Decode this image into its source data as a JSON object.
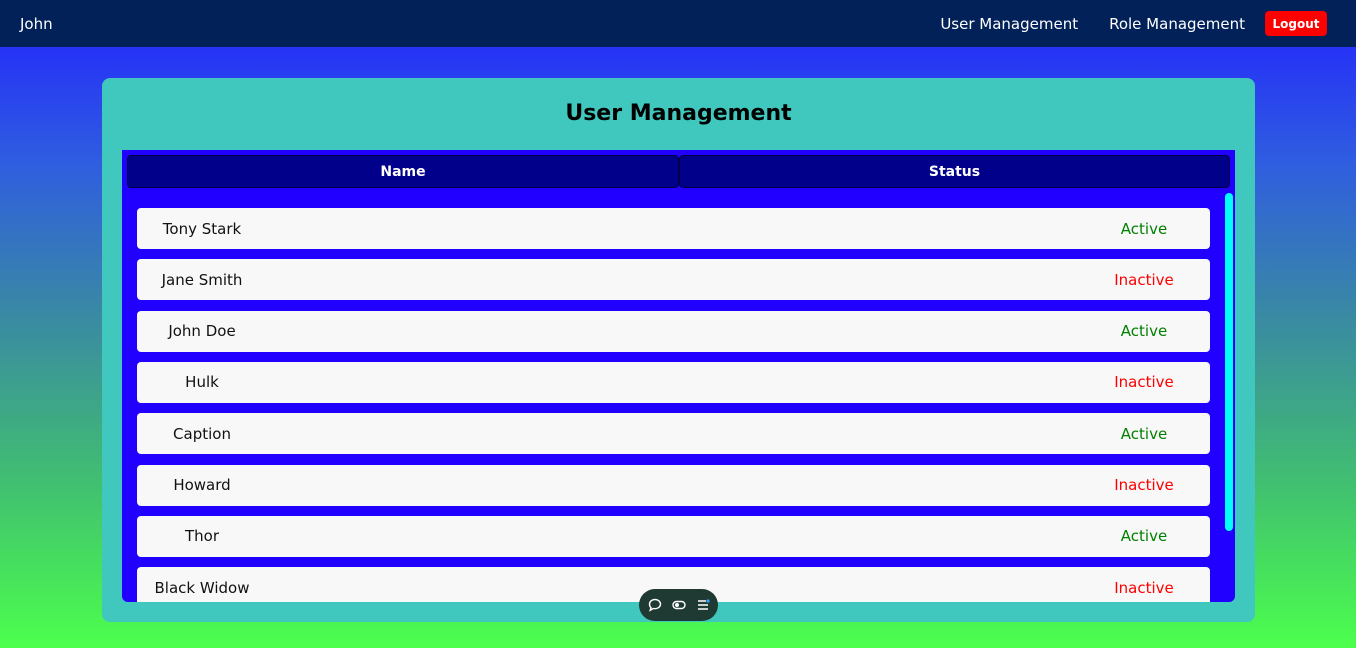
{
  "navbar": {
    "brand": "John",
    "links": [
      "User Management",
      "Role Management"
    ],
    "logout_label": "Logout"
  },
  "card": {
    "title": "User Management",
    "columns": [
      "Name",
      "Status"
    ]
  },
  "users": [
    {
      "name": "Tony Stark",
      "status": "Active"
    },
    {
      "name": "Jane Smith",
      "status": "Inactive"
    },
    {
      "name": "John Doe",
      "status": "Active"
    },
    {
      "name": "Hulk",
      "status": "Inactive"
    },
    {
      "name": "Caption",
      "status": "Active"
    },
    {
      "name": "Howard",
      "status": "Inactive"
    },
    {
      "name": "Thor",
      "status": "Active"
    },
    {
      "name": "Black Widow",
      "status": "Inactive"
    }
  ],
  "toolbar": {
    "icons": [
      "chat-bubble-icon",
      "toggle-icon",
      "list-icon"
    ]
  },
  "colors": {
    "navbar": "#012158",
    "card": "#40c8be",
    "table_panel": "#2200ff",
    "header_cell": "#00008b",
    "active": "#008000",
    "inactive": "#ff0000",
    "logout": "#ff0000"
  }
}
